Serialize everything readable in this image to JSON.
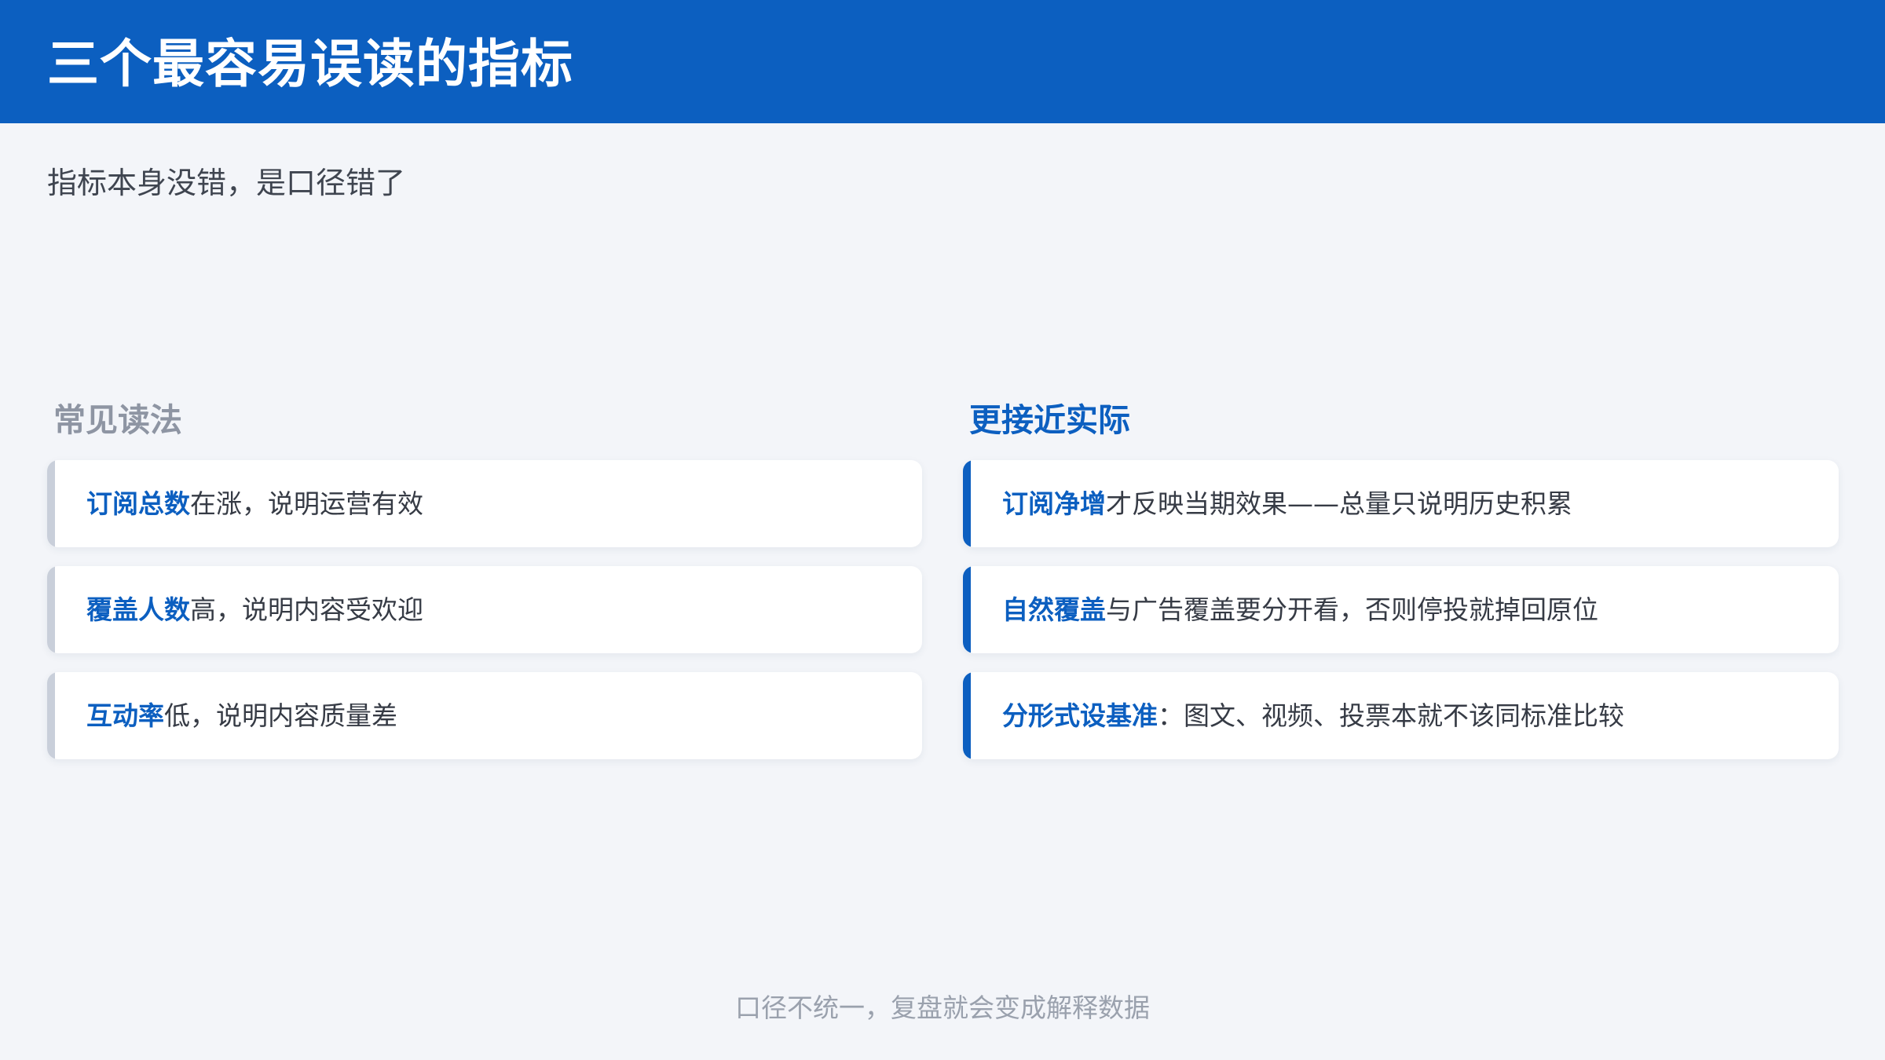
{
  "header": {
    "title": "三个最容易误读的指标",
    "subtitle": "指标本身没错，是口径错了"
  },
  "columns": {
    "left": {
      "heading": "常见读法",
      "cards": [
        {
          "key": "订阅总数",
          "text": "在涨，说明运营有效"
        },
        {
          "key": "覆盖人数",
          "text": "高，说明内容受欢迎"
        },
        {
          "key": "互动率",
          "text": "低，说明内容质量差"
        }
      ]
    },
    "right": {
      "heading": "更接近实际",
      "cards": [
        {
          "key": "订阅净增",
          "text": "才反映当期效果——总量只说明历史积累"
        },
        {
          "key": "自然覆盖",
          "text": "与广告覆盖要分开看，否则停投就掉回原位"
        },
        {
          "key": "分形式设基准",
          "text": "：图文、视频、投票本就不该同标准比较"
        }
      ]
    }
  },
  "footer": {
    "note": "口径不统一，复盘就会变成解释数据"
  },
  "colors": {
    "brand_blue": "#0c5fc0",
    "background": "#f3f5f9",
    "muted_gray": "#8e95a3"
  }
}
